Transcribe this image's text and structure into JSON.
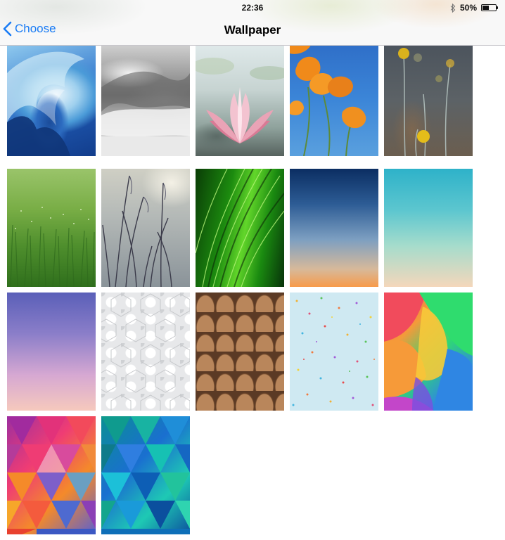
{
  "status_bar": {
    "time": "22:36",
    "battery_text": "50%",
    "battery_level": 0.5,
    "bluetooth_icon": "bluetooth-icon"
  },
  "nav": {
    "back_label": "Choose",
    "back_icon": "chevron-left-icon",
    "title": "Wallpaper",
    "accent_color": "#1a7cf5"
  },
  "wallpapers": [
    "blue-wave",
    "gray-wave",
    "pink-lotus",
    "orange-poppies",
    "yellow-flower-stems",
    "green-grass",
    "reeds",
    "green-leaf",
    "blue-orange-gradient",
    "teal-peach-gradient",
    "purple-pink-gradient",
    "white-hexagons",
    "wood-shingles",
    "confetti-dots",
    "colorful-shapes",
    "warm-triangles",
    "cool-triangles"
  ]
}
